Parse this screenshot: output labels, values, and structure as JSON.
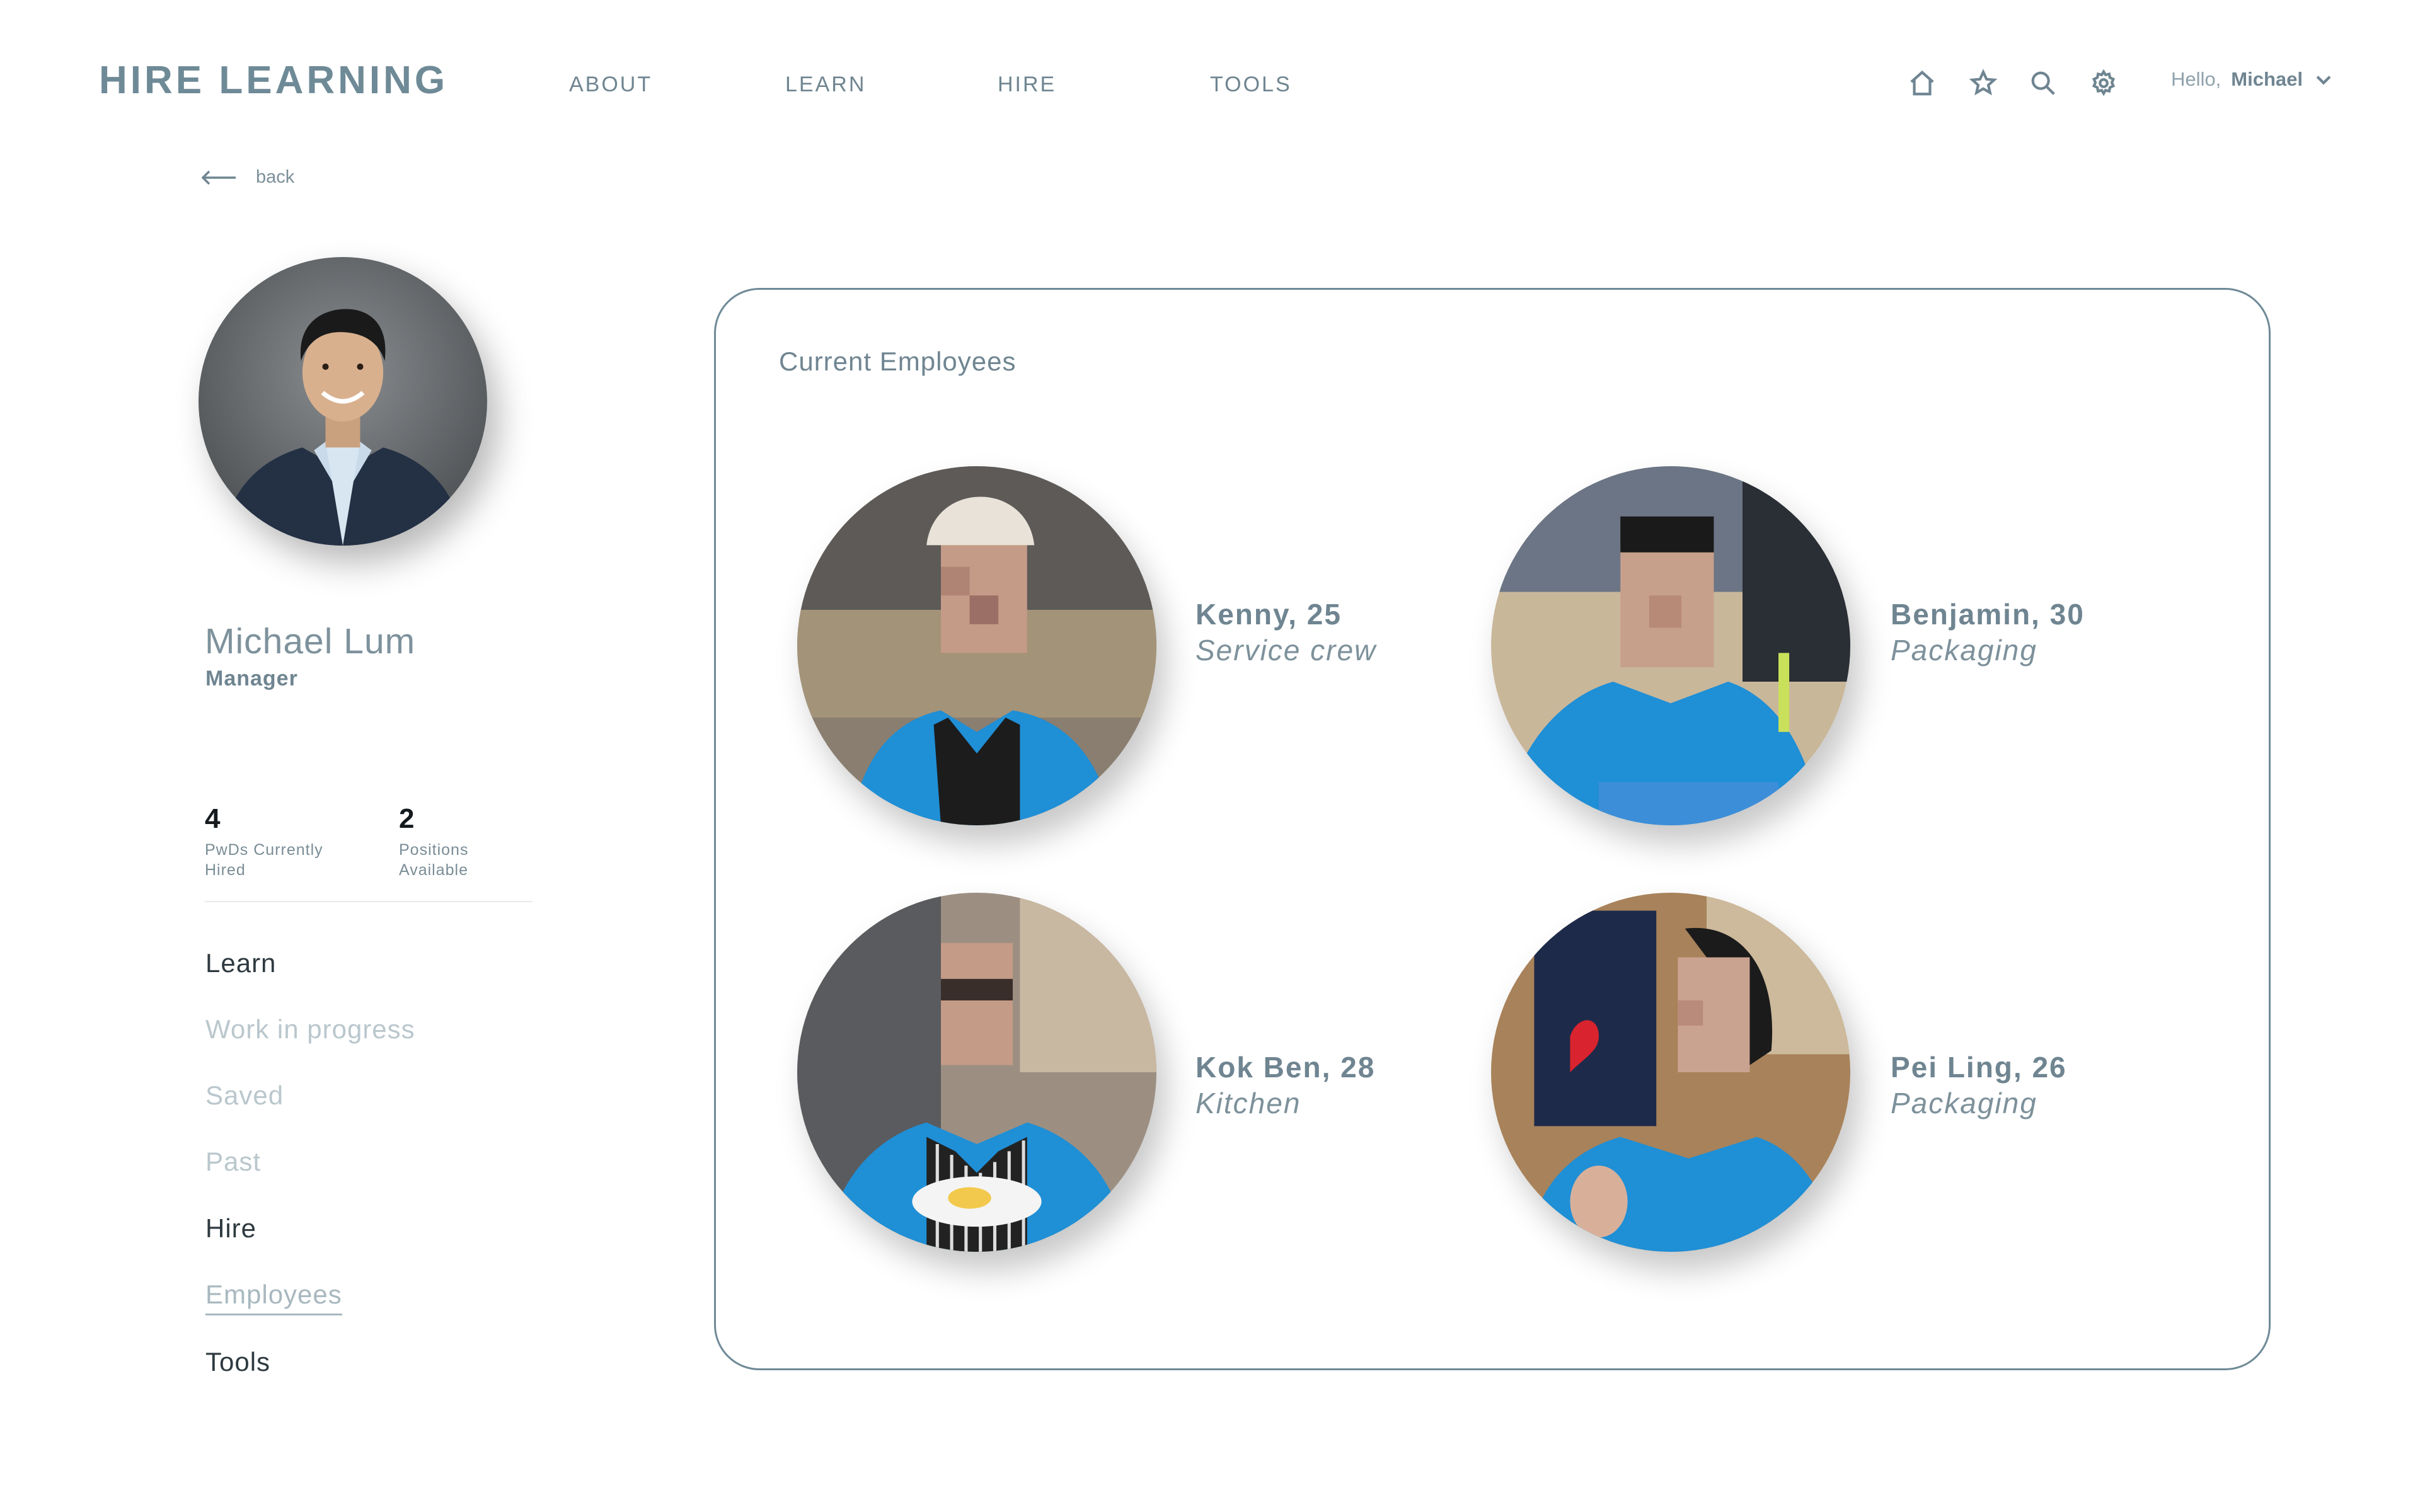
{
  "header": {
    "logo": "HIRE LEARNING",
    "nav": [
      {
        "label": "ABOUT"
      },
      {
        "label": "LEARN"
      },
      {
        "label": "HIRE"
      },
      {
        "label": "TOOLS"
      }
    ],
    "icons": [
      "home-icon",
      "star-icon",
      "search-icon",
      "gear-icon"
    ],
    "greeting": "Hello,",
    "user_name": "Michael"
  },
  "back_label": "back",
  "profile": {
    "name": "Michael Lum",
    "role": "Manager",
    "stats": [
      {
        "value": "4",
        "label_line1": "PwDs Currently",
        "label_line2": "Hired"
      },
      {
        "value": "2",
        "label_line1": "Positions",
        "label_line2": "Available"
      }
    ]
  },
  "sidebar": {
    "items": [
      {
        "label": "Learn"
      },
      {
        "label": "Work in progress"
      },
      {
        "label": "Saved"
      },
      {
        "label": "Past"
      },
      {
        "label": "Hire"
      },
      {
        "label": "Employees"
      },
      {
        "label": "Tools"
      }
    ]
  },
  "main": {
    "title": "Current Employees",
    "employees": [
      {
        "name": "Kenny, 25",
        "role": "Service crew"
      },
      {
        "name": "Benjamin, 30",
        "role": "Packaging"
      },
      {
        "name": "Kok Ben, 28",
        "role": "Kitchen"
      },
      {
        "name": "Pei Ling, 26",
        "role": "Packaging"
      }
    ]
  },
  "colors": {
    "accent": "#6f8a97",
    "text_dark": "#2e3a40",
    "text_muted": "#bac7cd",
    "shirt_blue": "#1f8fd6"
  }
}
